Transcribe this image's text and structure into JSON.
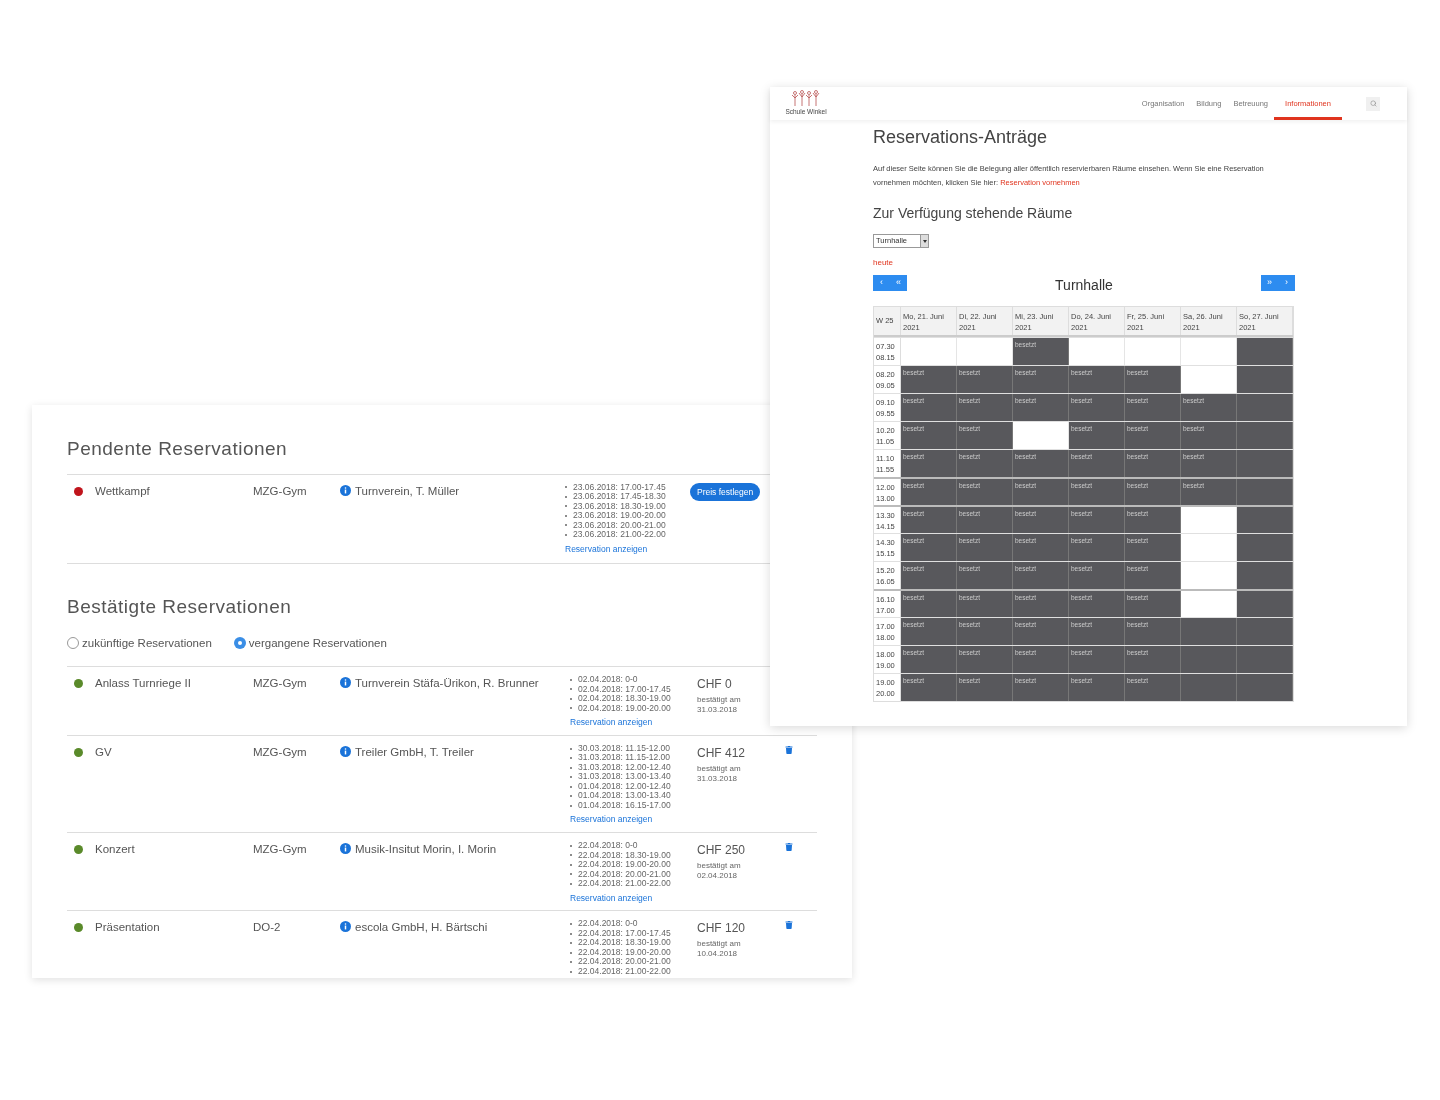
{
  "reservations_window": {
    "pending": {
      "title": "Pendente Reservationen",
      "rows": [
        {
          "color": "#c0141c",
          "name": "Wettkampf",
          "room": "MZG-Gym",
          "organizer": "Turnverein, T. Müller",
          "dates": [
            "23.06.2018: 17.00-17.45",
            "23.06.2018: 17.45-18.30",
            "23.06.2018: 18.30-19.00",
            "23.06.2018: 19.00-20.00",
            "23.06.2018: 20.00-21.00",
            "23.06.2018: 21.00-22.00"
          ],
          "link": "Reservation anzeigen",
          "action": "Preis festlegen"
        }
      ]
    },
    "confirmed": {
      "title": "Bestätigte Reservationen",
      "filters": [
        {
          "label": "zukünftige Reservationen",
          "selected": false
        },
        {
          "label": "vergangene Reservationen",
          "selected": true
        }
      ],
      "rows": [
        {
          "color": "#5a8a2a",
          "name": "Anlass Turnriege II",
          "room": "MZG-Gym",
          "organizer": "Turnverein Stäfa-Ürikon, R. Brunner",
          "dates": [
            "02.04.2018: 0-0",
            "02.04.2018: 17.00-17.45",
            "02.04.2018: 18.30-19.00",
            "02.04.2018: 19.00-20.00"
          ],
          "link": "Reservation anzeigen",
          "price": "CHF 0",
          "confirmed_label": "bestätigt am",
          "confirmed_date": "31.03.2018",
          "delete_icon": false
        },
        {
          "color": "#5a8a2a",
          "name": "GV",
          "room": "MZG-Gym",
          "organizer": "Treiler GmbH, T. Treiler",
          "dates": [
            "30.03.2018: 11.15-12.00",
            "31.03.2018: 11.15-12.00",
            "31.03.2018: 12.00-12.40",
            "31.03.2018: 13.00-13.40",
            "01.04.2018: 12.00-12.40",
            "01.04.2018: 13.00-13.40",
            "01.04.2018: 16.15-17.00"
          ],
          "link": "Reservation anzeigen",
          "price": "CHF 412",
          "confirmed_label": "bestätigt am",
          "confirmed_date": "31.03.2018",
          "delete_icon": true
        },
        {
          "color": "#5a8a2a",
          "name": "Konzert",
          "room": "MZG-Gym",
          "organizer": "Musik-Insitut Morin, I. Morin",
          "dates": [
            "22.04.2018: 0-0",
            "22.04.2018: 18.30-19.00",
            "22.04.2018: 19.00-20.00",
            "22.04.2018: 20.00-21.00",
            "22.04.2018: 21.00-22.00"
          ],
          "link": "Reservation anzeigen",
          "price": "CHF 250",
          "confirmed_label": "bestätigt am",
          "confirmed_date": "02.04.2018",
          "delete_icon": true
        },
        {
          "color": "#5a8a2a",
          "name": "Präsentation",
          "room": "DO-2",
          "organizer": "escola GmbH, H. Bärtschi",
          "dates": [
            "22.04.2018: 0-0",
            "22.04.2018: 17.00-17.45",
            "22.04.2018: 18.30-19.00",
            "22.04.2018: 19.00-20.00",
            "22.04.2018: 20.00-21.00",
            "22.04.2018: 21.00-22.00"
          ],
          "price": "CHF 120",
          "confirmed_label": "bestätigt am",
          "confirmed_date": "10.04.2018",
          "delete_icon": true
        }
      ]
    }
  },
  "website_window": {
    "logo_text": "Schule Winkel",
    "nav": [
      {
        "label": "Organisation",
        "selected": false
      },
      {
        "label": "Bildung",
        "selected": false
      },
      {
        "label": "Betreuung",
        "selected": false
      },
      {
        "label": "Informationen",
        "selected": true
      }
    ],
    "title": "Reservations-Anträge",
    "intro": "Auf dieser Seite können Sie die Belegung aller öffentlich reservierbaren Räume einsehen. Wenn Sie eine Reservation vornehmen möchten, klicken Sie hier:",
    "intro_link": "Reservation vornehmen",
    "subtitle": "Zur Verfügung stehende Räume",
    "room_select": {
      "value": "Turnhalle"
    },
    "today_link": "heute",
    "calendar": {
      "title": "Turnhalle",
      "prev_buttons": [
        "‹",
        "«"
      ],
      "next_buttons": [
        "»",
        "›"
      ],
      "week": "W 25",
      "days": [
        {
          "day": "Mo, 21. Juni",
          "year": "2021"
        },
        {
          "day": "Di, 22. Juni",
          "year": "2021"
        },
        {
          "day": "Mi, 23. Juni",
          "year": "2021"
        },
        {
          "day": "Do, 24. Juni",
          "year": "2021"
        },
        {
          "day": "Fr, 25. Juni",
          "year": "2021"
        },
        {
          "day": "Sa, 26. Juni",
          "year": "2021"
        },
        {
          "day": "So, 27. Juni",
          "year": "2021"
        }
      ],
      "rows": [
        {
          "start": "07.30",
          "end": "08.15",
          "break": false,
          "cells": [
            {
              "kind": "free"
            },
            {
              "kind": "free"
            },
            {
              "kind": "booked",
              "text": "besetzt"
            },
            {
              "kind": "free"
            },
            {
              "kind": "free"
            },
            {
              "kind": "free"
            },
            {
              "kind": "closed"
            }
          ]
        },
        {
          "start": "08.20",
          "end": "09.05",
          "break": false,
          "cells": [
            {
              "kind": "booked",
              "text": "besetzt"
            },
            {
              "kind": "booked",
              "text": "besetzt"
            },
            {
              "kind": "booked",
              "text": "besetzt"
            },
            {
              "kind": "booked",
              "text": "besetzt"
            },
            {
              "kind": "booked",
              "text": "besetzt"
            },
            {
              "kind": "free"
            },
            {
              "kind": "closed"
            }
          ]
        },
        {
          "start": "09.10",
          "end": "09.55",
          "break": false,
          "cells": [
            {
              "kind": "booked",
              "text": "besetzt"
            },
            {
              "kind": "booked",
              "text": "besetzt"
            },
            {
              "kind": "booked",
              "text": "besetzt"
            },
            {
              "kind": "booked",
              "text": "besetzt"
            },
            {
              "kind": "booked",
              "text": "besetzt"
            },
            {
              "kind": "booked",
              "text": "besetzt"
            },
            {
              "kind": "closed"
            }
          ]
        },
        {
          "start": "10.20",
          "end": "11.05",
          "break": false,
          "cells": [
            {
              "kind": "booked",
              "text": "besetzt"
            },
            {
              "kind": "booked",
              "text": "besetzt"
            },
            {
              "kind": "free"
            },
            {
              "kind": "booked",
              "text": "besetzt"
            },
            {
              "kind": "booked",
              "text": "besetzt"
            },
            {
              "kind": "booked",
              "text": "besetzt"
            },
            {
              "kind": "closed"
            }
          ]
        },
        {
          "start": "11.10",
          "end": "11.55",
          "break": false,
          "cells": [
            {
              "kind": "booked",
              "text": "besetzt"
            },
            {
              "kind": "booked",
              "text": "besetzt"
            },
            {
              "kind": "booked",
              "text": "besetzt"
            },
            {
              "kind": "booked",
              "text": "besetzt"
            },
            {
              "kind": "booked",
              "text": "besetzt"
            },
            {
              "kind": "booked",
              "text": "besetzt"
            },
            {
              "kind": "closed"
            }
          ]
        },
        {
          "start": "12.00",
          "end": "13.00",
          "break": true,
          "cells": [
            {
              "kind": "booked",
              "text": "besetzt"
            },
            {
              "kind": "booked",
              "text": "besetzt"
            },
            {
              "kind": "booked",
              "text": "besetzt"
            },
            {
              "kind": "booked",
              "text": "besetzt"
            },
            {
              "kind": "booked",
              "text": "besetzt"
            },
            {
              "kind": "booked",
              "text": "besetzt"
            },
            {
              "kind": "closed"
            }
          ]
        },
        {
          "start": "13.30",
          "end": "14.15",
          "break": true,
          "cells": [
            {
              "kind": "booked",
              "text": "besetzt"
            },
            {
              "kind": "booked",
              "text": "besetzt"
            },
            {
              "kind": "booked",
              "text": "besetzt"
            },
            {
              "kind": "booked",
              "text": "besetzt"
            },
            {
              "kind": "booked",
              "text": "besetzt"
            },
            {
              "kind": "free"
            },
            {
              "kind": "closed"
            }
          ]
        },
        {
          "start": "14.30",
          "end": "15.15",
          "break": false,
          "cells": [
            {
              "kind": "booked",
              "text": "besetzt"
            },
            {
              "kind": "booked",
              "text": "besetzt"
            },
            {
              "kind": "booked",
              "text": "besetzt"
            },
            {
              "kind": "booked",
              "text": "besetzt"
            },
            {
              "kind": "booked",
              "text": "besetzt"
            },
            {
              "kind": "free"
            },
            {
              "kind": "closed"
            }
          ]
        },
        {
          "start": "15.20",
          "end": "16.05",
          "break": false,
          "cells": [
            {
              "kind": "booked",
              "text": "besetzt"
            },
            {
              "kind": "booked",
              "text": "besetzt"
            },
            {
              "kind": "booked",
              "text": "besetzt"
            },
            {
              "kind": "booked",
              "text": "besetzt"
            },
            {
              "kind": "booked",
              "text": "besetzt"
            },
            {
              "kind": "free"
            },
            {
              "kind": "closed"
            }
          ]
        },
        {
          "start": "16.10",
          "end": "17.00",
          "break": true,
          "cells": [
            {
              "kind": "booked",
              "text": "besetzt"
            },
            {
              "kind": "booked",
              "text": "besetzt"
            },
            {
              "kind": "booked",
              "text": "besetzt"
            },
            {
              "kind": "booked",
              "text": "besetzt"
            },
            {
              "kind": "booked",
              "text": "besetzt"
            },
            {
              "kind": "free"
            },
            {
              "kind": "closed"
            }
          ]
        },
        {
          "start": "17.00",
          "end": "18.00",
          "break": false,
          "cells": [
            {
              "kind": "booked",
              "text": "besetzt"
            },
            {
              "kind": "booked",
              "text": "besetzt"
            },
            {
              "kind": "booked",
              "text": "besetzt"
            },
            {
              "kind": "booked",
              "text": "besetzt"
            },
            {
              "kind": "booked",
              "text": "besetzt"
            },
            {
              "kind": "closed"
            },
            {
              "kind": "closed"
            }
          ]
        },
        {
          "start": "18.00",
          "end": "19.00",
          "break": false,
          "cells": [
            {
              "kind": "booked",
              "text": "besetzt"
            },
            {
              "kind": "booked",
              "text": "besetzt"
            },
            {
              "kind": "booked",
              "text": "besetzt"
            },
            {
              "kind": "booked",
              "text": "besetzt"
            },
            {
              "kind": "booked",
              "text": "besetzt"
            },
            {
              "kind": "closed"
            },
            {
              "kind": "closed"
            }
          ]
        },
        {
          "start": "19.00",
          "end": "20.00",
          "break": false,
          "cells": [
            {
              "kind": "booked",
              "text": "besetzt"
            },
            {
              "kind": "booked",
              "text": "besetzt"
            },
            {
              "kind": "booked",
              "text": "besetzt"
            },
            {
              "kind": "booked",
              "text": "besetzt"
            },
            {
              "kind": "booked",
              "text": "besetzt"
            },
            {
              "kind": "closed"
            },
            {
              "kind": "closed"
            }
          ]
        }
      ]
    }
  }
}
